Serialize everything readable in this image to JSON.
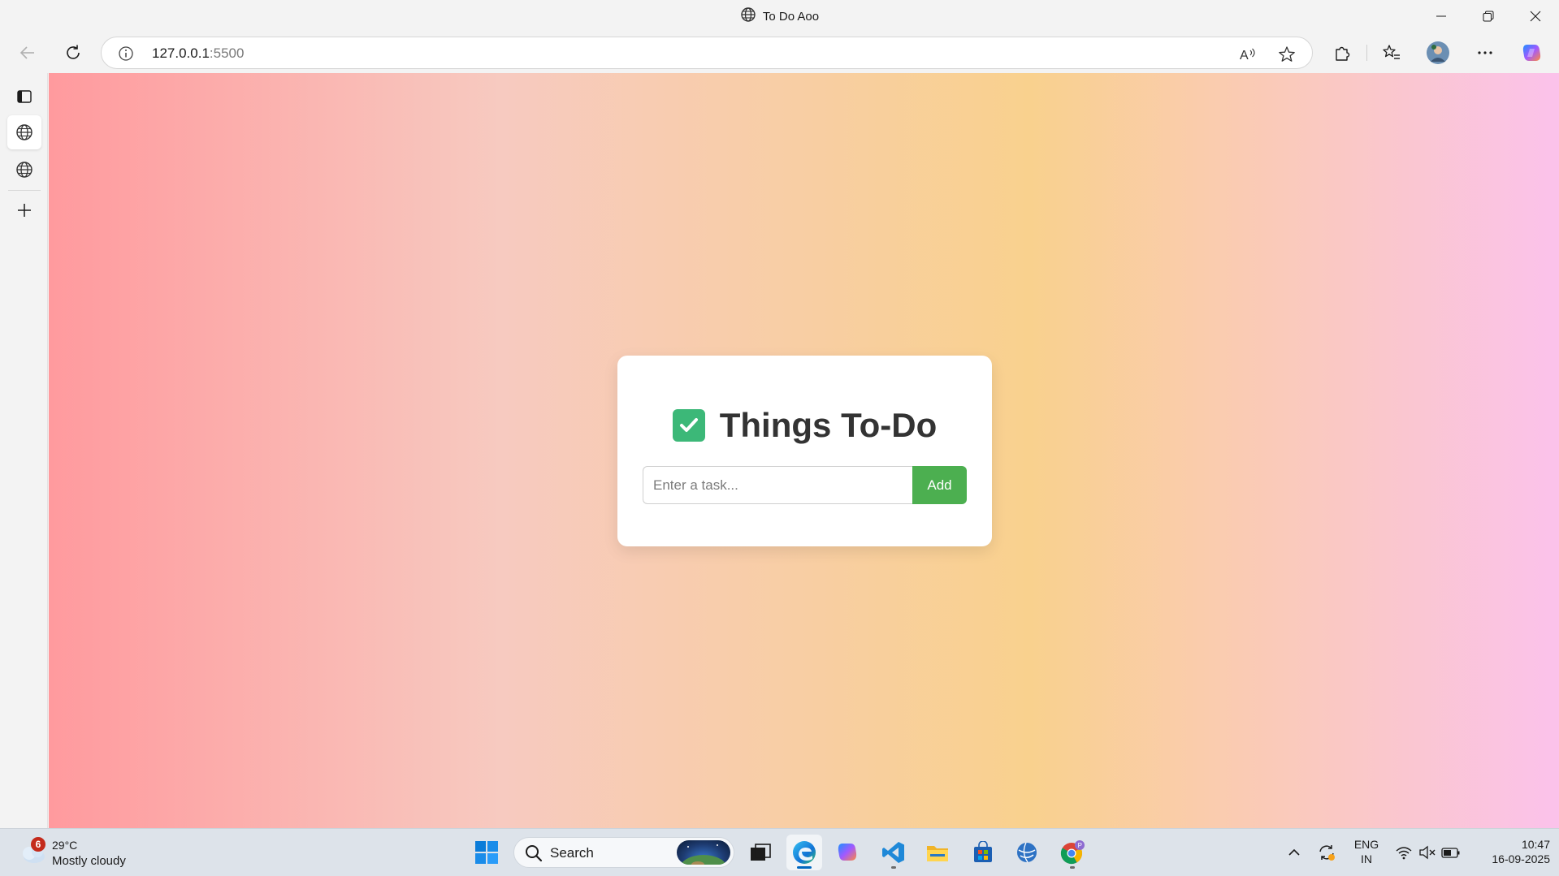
{
  "window": {
    "title": "To Do Aoo"
  },
  "toolbar": {
    "url_host": "127.0.0.1",
    "url_port": ":5500"
  },
  "page": {
    "title": "Things To-Do",
    "input_placeholder": "Enter a task...",
    "add_label": "Add",
    "colors": {
      "accent": "#4caf50",
      "gradient": [
        "#ff9a9e",
        "#f7cac0",
        "#f9d18e",
        "#fbc2eb"
      ]
    }
  },
  "taskbar": {
    "weather": {
      "badge": "6",
      "temp": "29°C",
      "desc": "Mostly cloudy"
    },
    "search_label": "Search",
    "lang_line1": "ENG",
    "lang_line2": "IN",
    "time": "10:47",
    "date": "16-09-2025"
  }
}
